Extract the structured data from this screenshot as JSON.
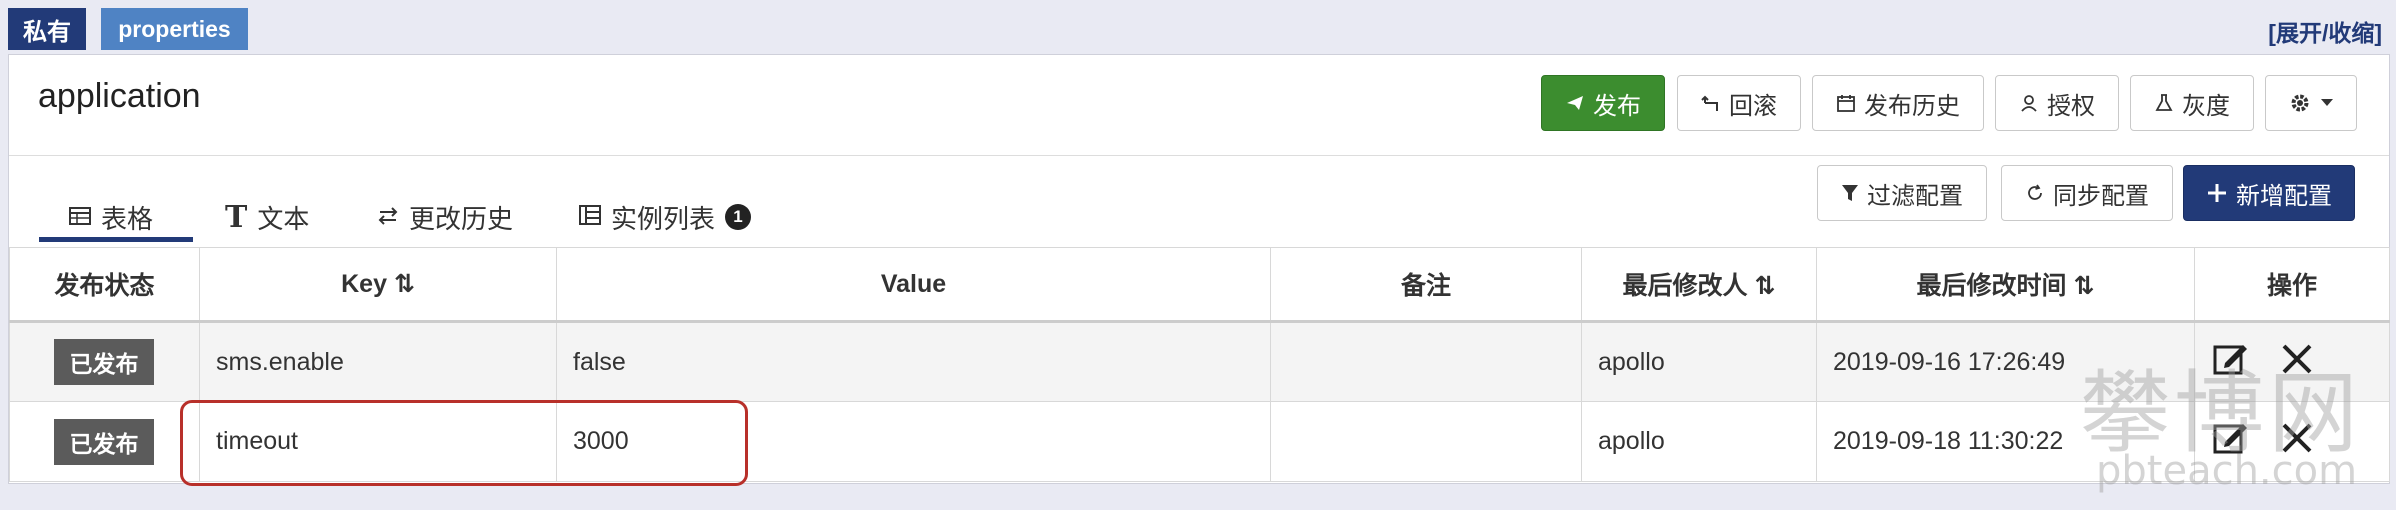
{
  "topbar": {
    "private_label": "私有",
    "namespace_label": "properties",
    "expand_label": "[展开/收缩]"
  },
  "header": {
    "title": "application",
    "buttons": {
      "publish": "发布",
      "rollback": "回滚",
      "publish_history": "发布历史",
      "authorize": "授权",
      "gray": "灰度"
    }
  },
  "tabs": [
    {
      "label": "表格",
      "active": true
    },
    {
      "label": "文本"
    },
    {
      "label": "更改历史"
    },
    {
      "label": "实例列表",
      "count": "1"
    }
  ],
  "actions": {
    "filter": "过滤配置",
    "sync": "同步配置",
    "add": "新增配置"
  },
  "table": {
    "columns": [
      "发布状态",
      "Key",
      "Value",
      "备注",
      "最后修改人",
      "最后修改时间",
      "操作"
    ],
    "rows": [
      {
        "status": "已发布",
        "key": "sms.enable",
        "value": "false",
        "comment": "",
        "modifier": "apollo",
        "time": "2019-09-16 17:26:49"
      },
      {
        "status": "已发布",
        "key": "timeout",
        "value": "3000",
        "comment": "",
        "modifier": "apollo",
        "time": "2019-09-18 11:30:22"
      }
    ]
  },
  "watermark": {
    "main": "攀博网",
    "sub": "pbteach.com"
  },
  "colors": {
    "primary_navy": "#223a78",
    "publish_green": "#3c8d2f",
    "namespace_blue": "#4f83c4",
    "highlight_red": "#b8302a"
  }
}
